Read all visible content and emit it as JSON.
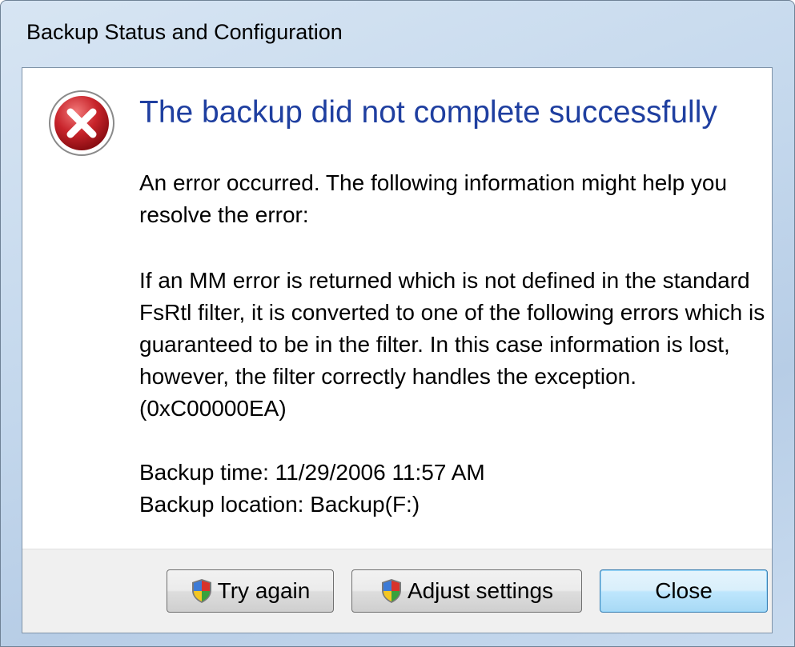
{
  "window": {
    "title": "Backup Status and Configuration"
  },
  "dialog": {
    "icon": "error-icon",
    "heading": "The backup did not complete successfully",
    "intro": "An error occurred. The following information might help you resolve the error:",
    "details": "If an MM error is returned which is not defined in the standard FsRtl filter, it is converted to one of the following errors which is guaranteed to be in the filter. In this case information is lost, however, the filter correctly handles the exception. (0xC00000EA)",
    "backup_time": "Backup time: 11/29/2006 11:57 AM",
    "backup_location": "Backup location: Backup(F:)"
  },
  "buttons": {
    "try_again": "Try again",
    "adjust_settings": "Adjust settings",
    "close": "Close"
  },
  "colors": {
    "heading": "#1f3fa0",
    "error_red": "#c8242b",
    "default_button_border": "#3c7fb1"
  }
}
